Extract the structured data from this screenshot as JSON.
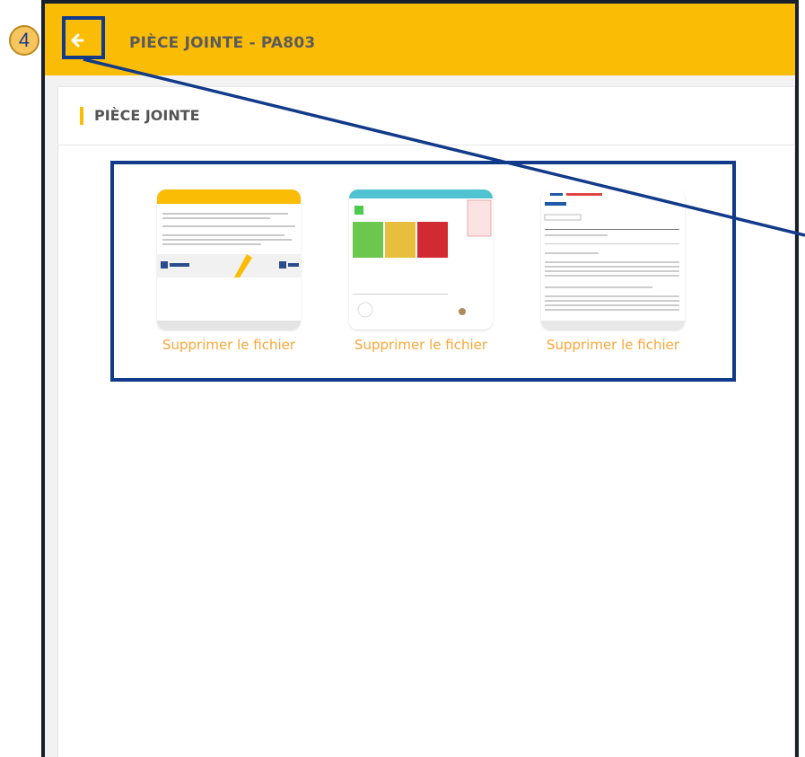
{
  "header": {
    "title": "PIÈCE JOINTE - PA803",
    "back_icon": "arrow-left-icon",
    "color": "#fbbc05"
  },
  "section": {
    "title": "PIÈCE JOINTE"
  },
  "attachments": [
    {
      "thumbnail": "document-preview",
      "delete_label": "Supprimer le fichier"
    },
    {
      "thumbnail": "dashboard-preview",
      "delete_label": "Supprimer le fichier"
    },
    {
      "thumbnail": "table-preview",
      "delete_label": "Supprimer le fichier"
    }
  ],
  "annotation": {
    "step_number": "4",
    "highlight_color": "#123a8a"
  },
  "colors": {
    "accent": "#fbbc05",
    "link": "#fba635"
  }
}
